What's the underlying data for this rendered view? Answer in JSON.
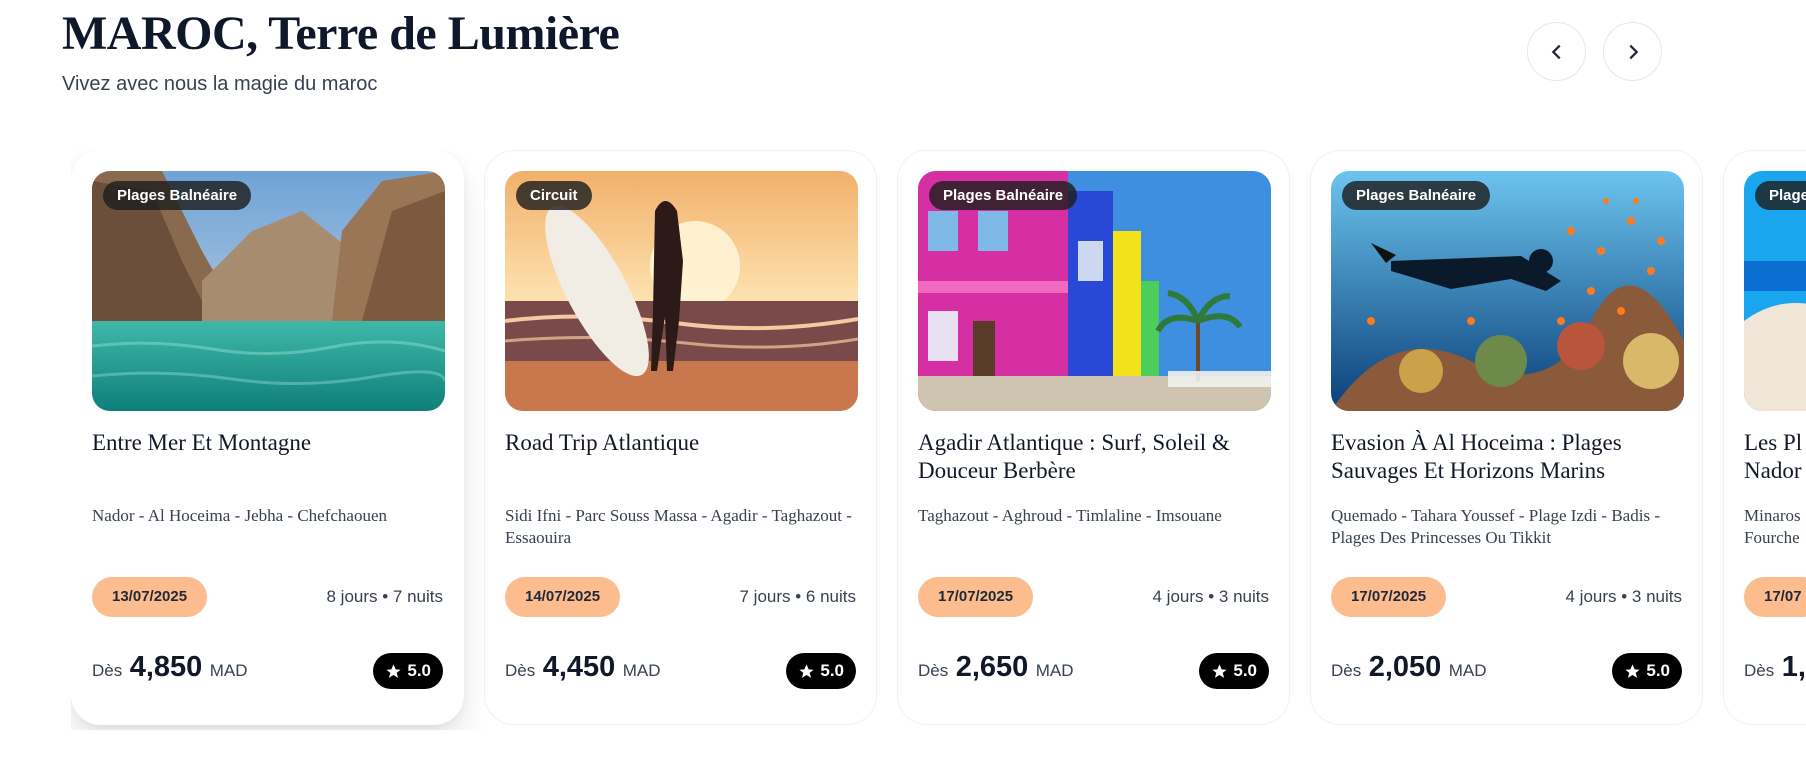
{
  "header": {
    "title": "MAROC, Terre de Lumière",
    "subtitle": "Vivez avec nous la magie du maroc"
  },
  "nav": {
    "prev_icon": "chevron-left-icon",
    "next_icon": "chevron-right-icon"
  },
  "cards": [
    {
      "tag": "Plages Balnéaire",
      "title": "Entre Mer Et Montagne",
      "route": "Nador - Al Hoceima - Jebha - Chefchaouen",
      "date": "13/07/2025",
      "duration": "8 jours • 7 nuits",
      "price_from": "Dès",
      "price": "4,850",
      "currency": "MAD",
      "rating": "5.0"
    },
    {
      "tag": "Circuit",
      "title": "Road Trip Atlantique",
      "route": "Sidi Ifni - Parc Souss Massa - Agadir - Taghazout - Essaouira",
      "date": "14/07/2025",
      "duration": "7 jours • 6 nuits",
      "price_from": "Dès",
      "price": "4,450",
      "currency": "MAD",
      "rating": "5.0"
    },
    {
      "tag": "Plages Balnéaire",
      "title": "Agadir Atlantique : Surf, Soleil & Douceur Berbère",
      "route": "Taghazout - Aghroud - Timlaline - Imsouane",
      "date": "17/07/2025",
      "duration": "4 jours • 3 nuits",
      "price_from": "Dès",
      "price": "2,650",
      "currency": "MAD",
      "rating": "5.0"
    },
    {
      "tag": "Plages Balnéaire",
      "title": "Evasion À Al Hoceima : Plages Sauvages Et Horizons Marins",
      "route": "Quemado - Tahara Youssef - Plage Izdi - Badis - Plages Des Princesses Ou Tikkit",
      "date": "17/07/2025",
      "duration": "4 jours • 3 nuits",
      "price_from": "Dès",
      "price": "2,050",
      "currency": "MAD",
      "rating": "5.0"
    },
    {
      "tag": "Plage",
      "title": "Les Pl",
      "title_line2": "Nador",
      "route": "Minaros",
      "route_line2": "Fourche",
      "date": "17/07",
      "duration": "",
      "price_from": "Dès",
      "price": "1,",
      "currency": "",
      "rating": ""
    }
  ],
  "colors": {
    "date_pill": "#fcbc8e",
    "title_highlight": "#fbc7c1",
    "rating_bg": "#000000"
  }
}
